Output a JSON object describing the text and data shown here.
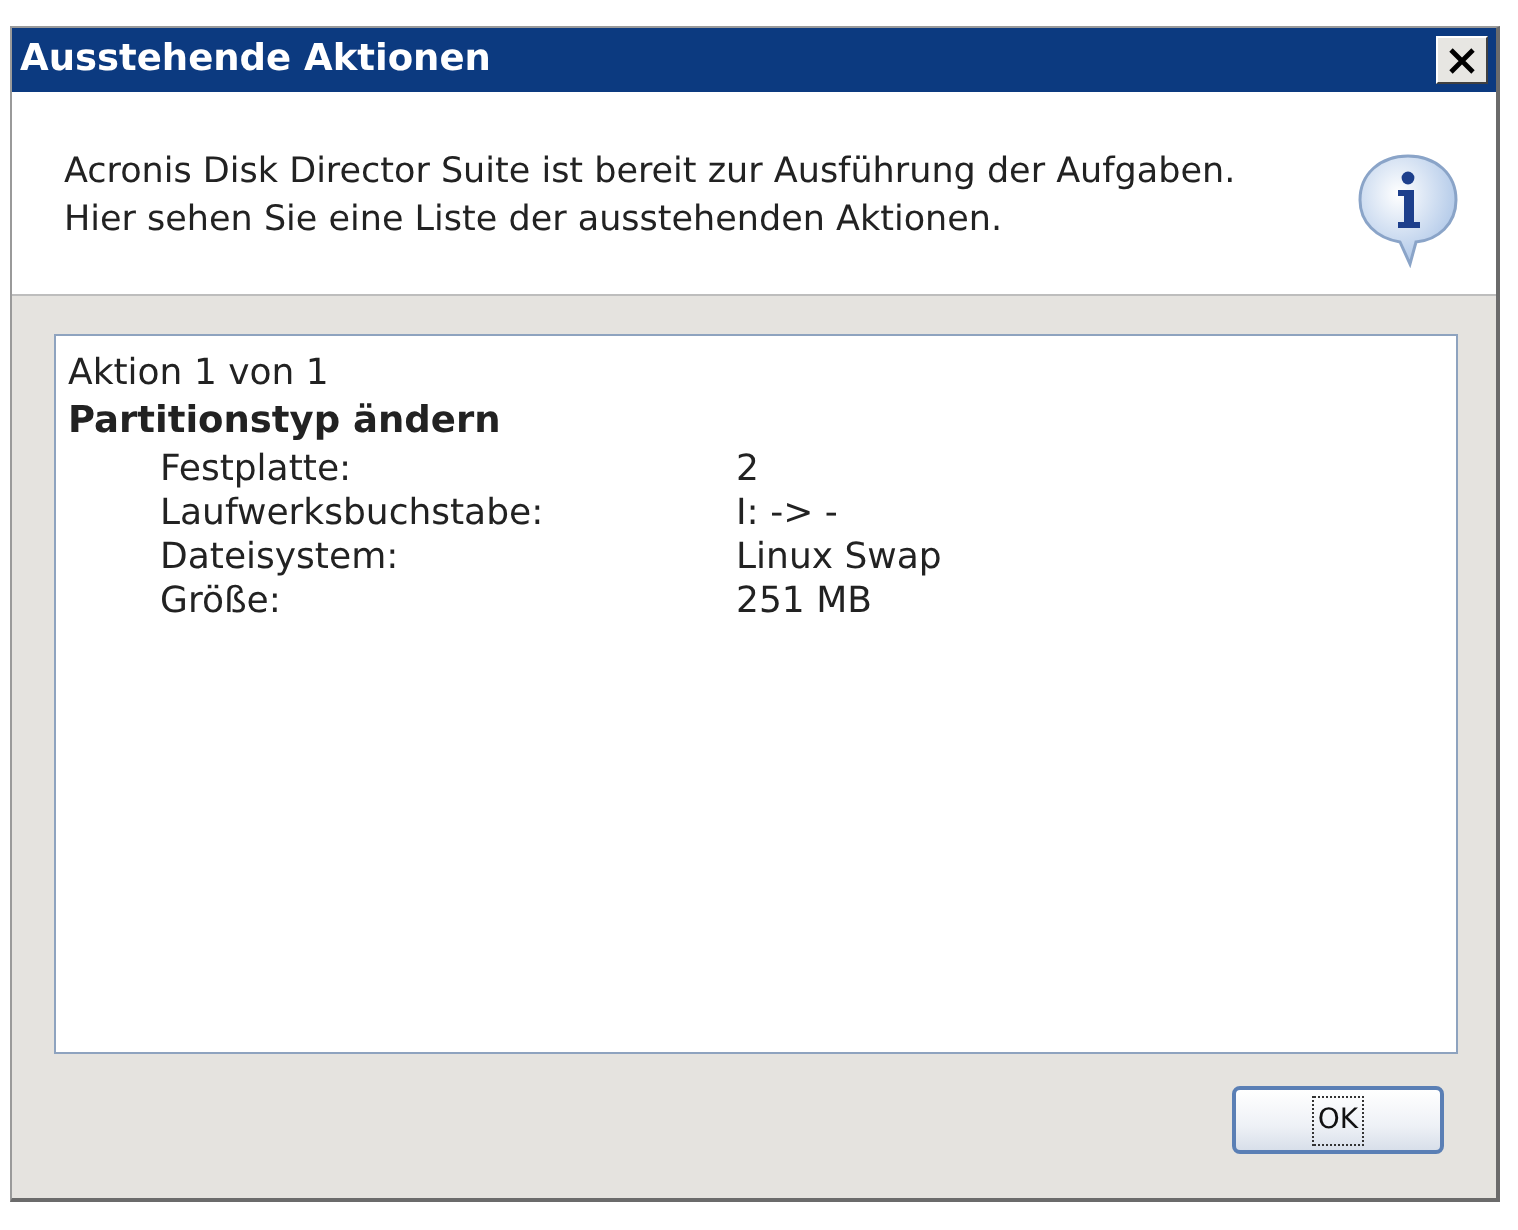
{
  "window": {
    "title": "Ausstehende Aktionen"
  },
  "header": {
    "lines": [
      "Acronis Disk Director Suite ist bereit zur Ausführung der Aufgaben.",
      "Hier sehen Sie eine Liste der ausstehenden Aktionen."
    ]
  },
  "actions_list": {
    "counter": "Aktion 1 von 1",
    "action_title": "Partitionstyp ändern",
    "properties": [
      {
        "label": "Festplatte:",
        "value": "2"
      },
      {
        "label": "Laufwerksbuchstabe:",
        "value": "I: -> -"
      },
      {
        "label": "Dateisystem:",
        "value": "Linux Swap"
      },
      {
        "label": "Größe:",
        "value": "251 MB"
      }
    ]
  },
  "buttons": [
    {
      "label": "OK",
      "focused": true
    }
  ]
}
